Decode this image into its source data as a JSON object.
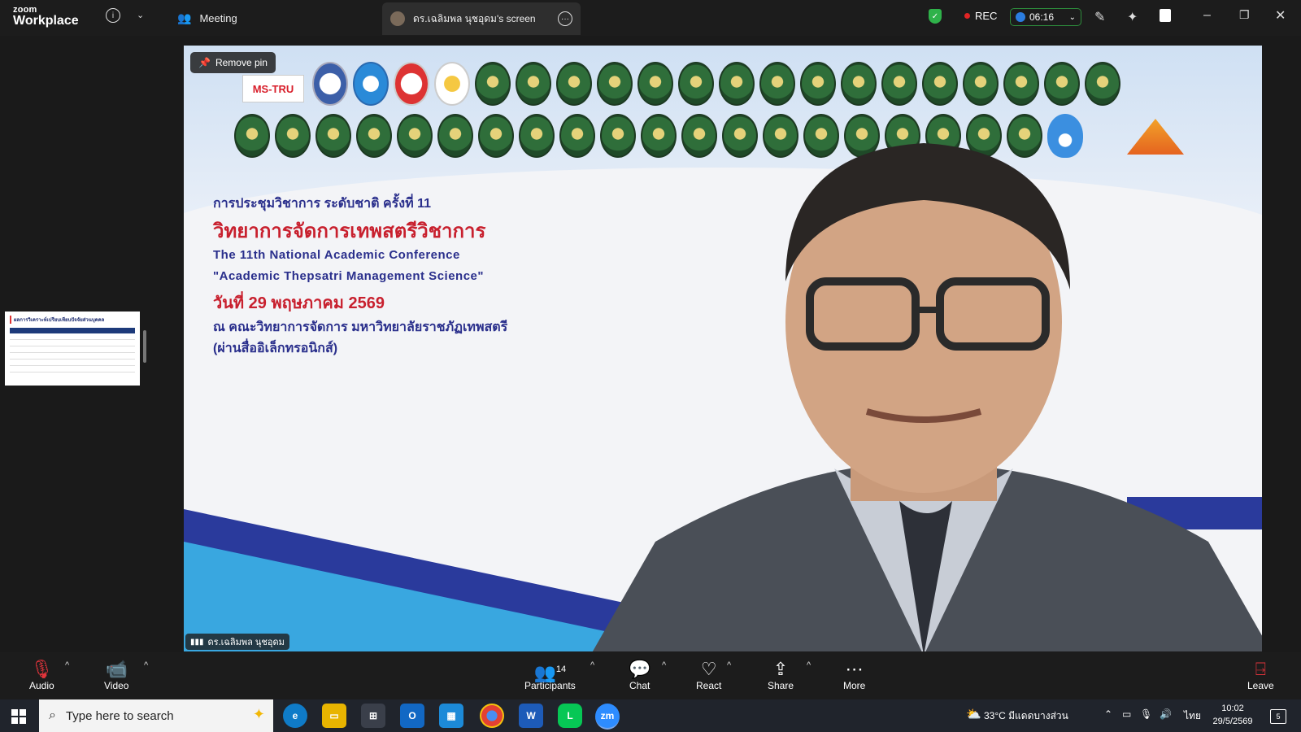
{
  "app": {
    "logo_line1": "zoom",
    "logo_line2": "Workplace"
  },
  "topbar": {
    "meeting_label": "Meeting",
    "screen_tab_label": "ดร.เฉลิมพล นุชอุดม's screen",
    "rec_label": "REC",
    "timer_value": "06:16"
  },
  "video": {
    "remove_pin_label": "Remove pin",
    "logo_text": "MS-TRU",
    "slide_lines": [
      "การประชุมวิชาการ ระดับชาติ ครั้งที่ 11",
      "วิทยาการจัดการเทพสตรีวิชาการ",
      "The 11th National Academic Conference",
      "\"Academic Thepsatri Management Science\"",
      "วันที่ 29 พฤษภาคม 2569",
      "ณ คณะวิทยาการจัดการ มหาวิทยาลัยราชภัฏเทพสตรี",
      "(ผ่านสื่ออิเล็กทรอนิกส์)"
    ],
    "speaker_name": "ดร.เฉลิมพล นุชอุดม"
  },
  "thumbnail": {
    "title": "ผลการวิเคราะห์เปรียบเทียบปัจจัยส่วนบุคคล"
  },
  "toolbar": {
    "audio_label": "Audio",
    "video_label": "Video",
    "participants_label": "Participants",
    "participants_count": "14",
    "chat_label": "Chat",
    "react_label": "React",
    "share_label": "Share",
    "more_label": "More",
    "leave_label": "Leave"
  },
  "taskbar": {
    "search_placeholder": "Type here to search",
    "weather": "33°C มีแดดบางส่วน",
    "language": "ไทย",
    "time": "10:02",
    "date": "29/5/2569",
    "notifications": "5"
  },
  "colors": {
    "accent_red": "#c8202e",
    "slide_blue": "#2a2f8c",
    "rec_red": "#e02424",
    "timer_green": "#2d8c3c"
  }
}
